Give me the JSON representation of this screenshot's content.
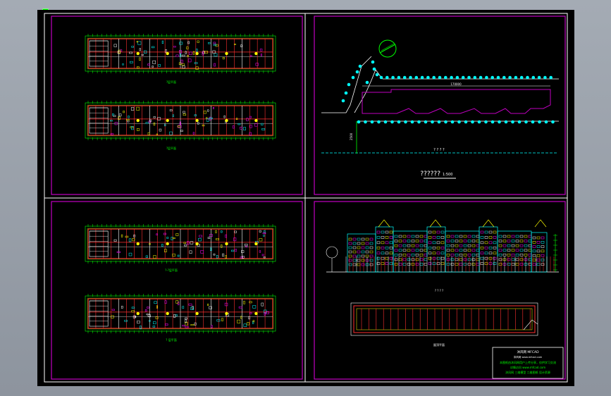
{
  "drawing": {
    "panels": [
      {
        "id": "floor-plans-top",
        "labels": [
          "?层平面",
          "?层平面"
        ]
      },
      {
        "id": "site-plan",
        "dimension": "170000",
        "side_dimension": "2500",
        "caption_note": "? ? ? ?",
        "title": "??????",
        "scale": "1:500"
      },
      {
        "id": "floor-plans-bottom",
        "labels": [
          "?-?层平面",
          "? 层平面"
        ]
      },
      {
        "id": "elevation-roof",
        "elevation_label": "? ? ? ?",
        "roof_label": "屋顶平面"
      }
    ],
    "title_block": {
      "row1": "沐风网  MFCAD",
      "row2": "沐风网  www.mfcad.com",
      "row3": "本图纸由沐风网用户上传分享，仅供学习交流",
      "row4": "详情访问 www.mfcad.com",
      "row5": "沐风网 三维模型 二维图纸 设计资源"
    },
    "colors": {
      "border": "#c000c0",
      "wall": "#ff3030",
      "green": "#00ff00",
      "cyan": "#00ffff",
      "yellow": "#ffff00",
      "white": "#ffffff"
    }
  }
}
